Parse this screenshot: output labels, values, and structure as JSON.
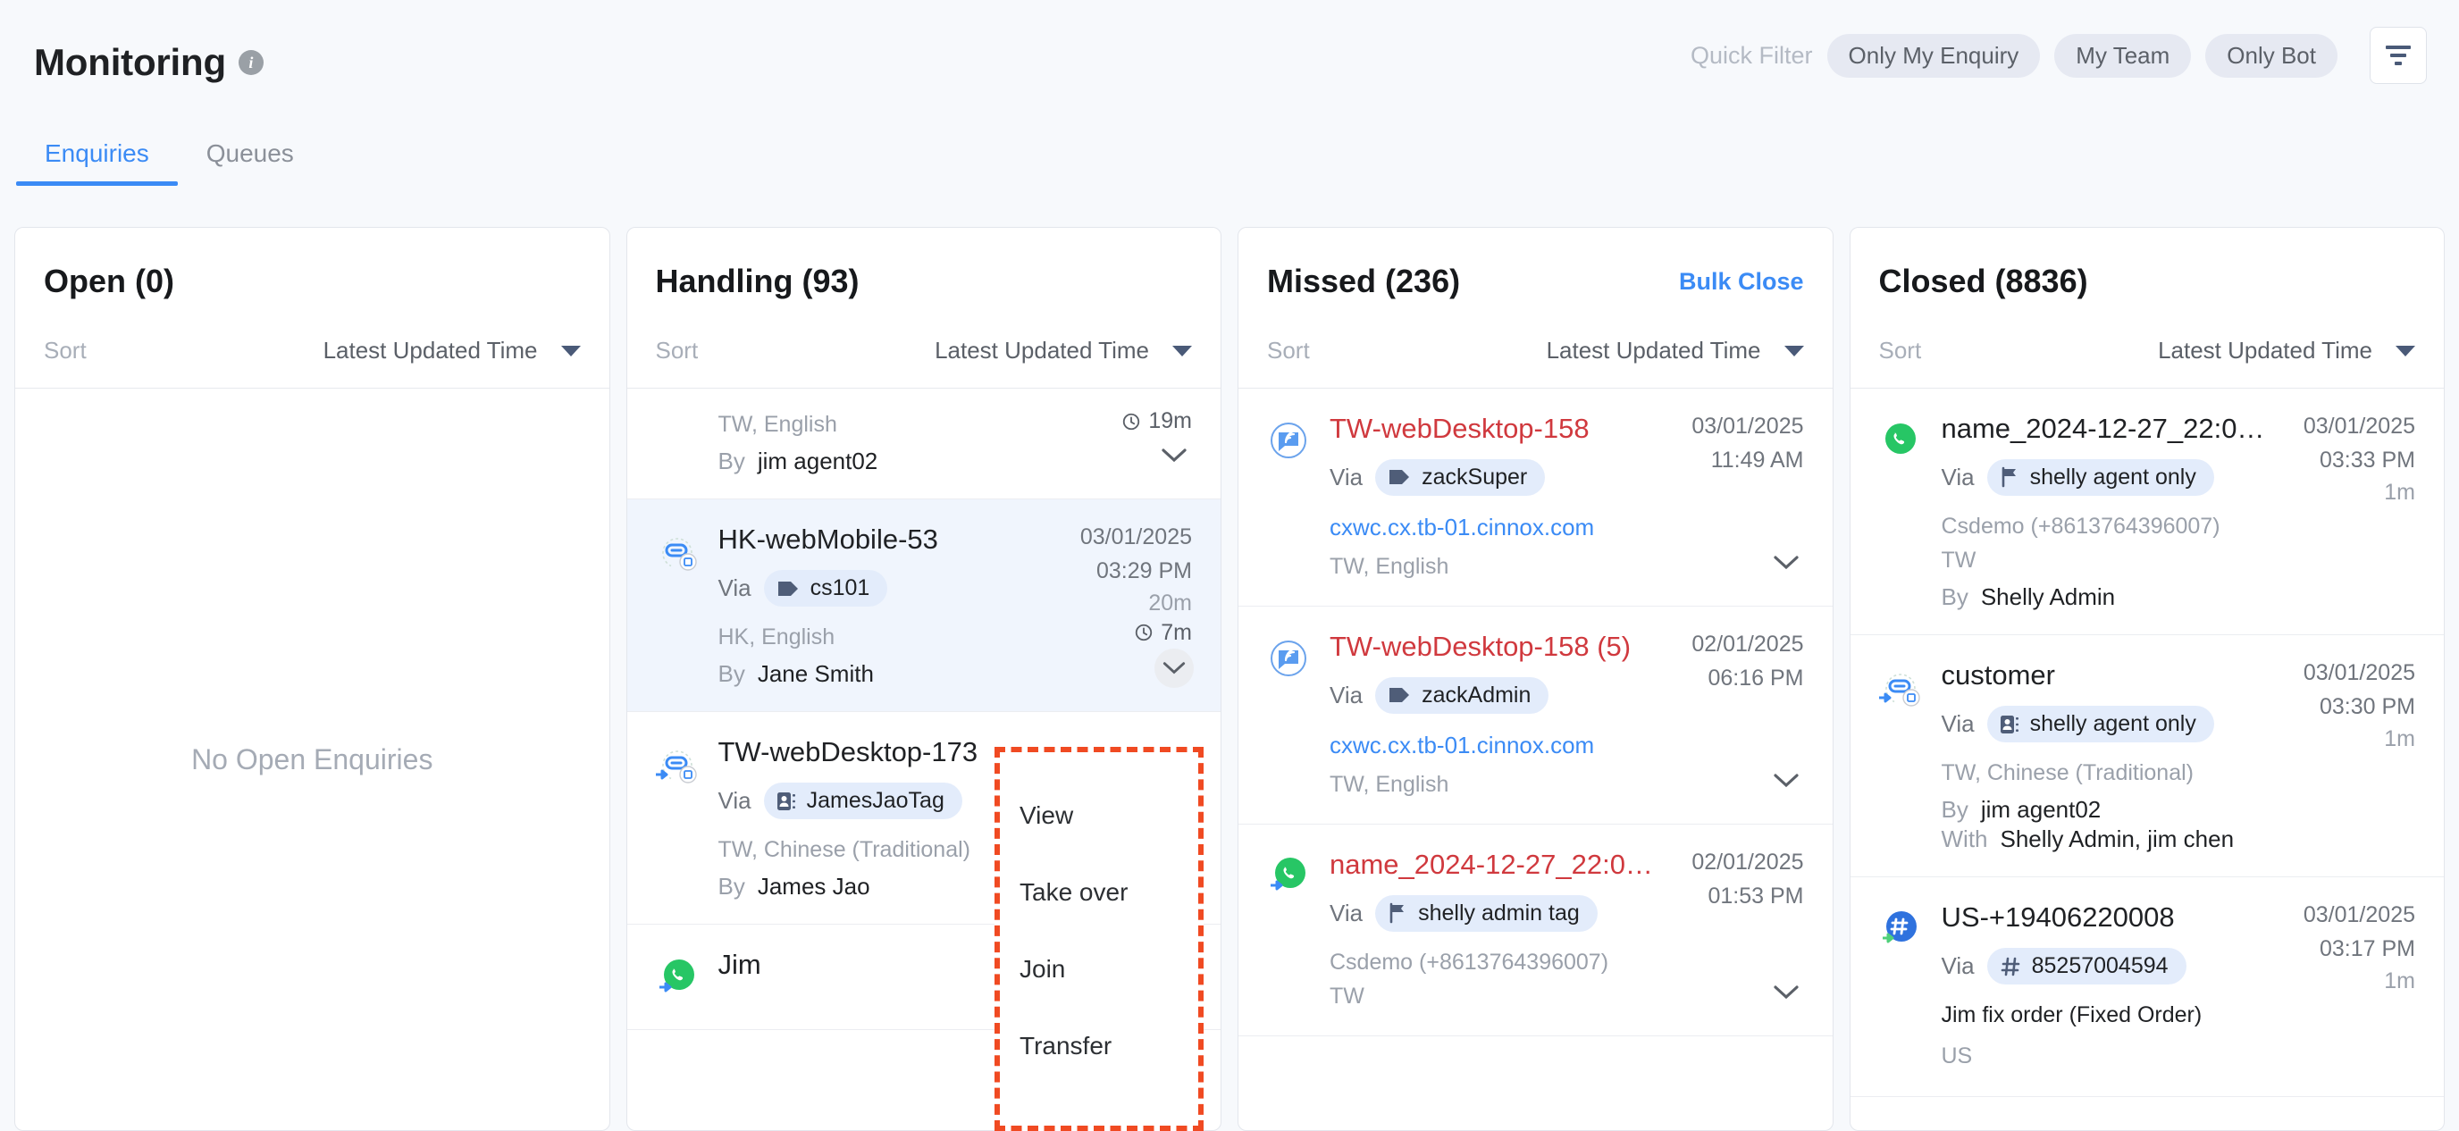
{
  "header": {
    "title": "Monitoring",
    "info_icon": "info-icon",
    "quick_filter_label": "Quick Filter",
    "chips": [
      {
        "label": "Only My Enquiry"
      },
      {
        "label": "My Team"
      },
      {
        "label": "Only Bot"
      }
    ],
    "filter_button_icon": "filter-icon"
  },
  "tabs": [
    {
      "label": "Enquiries",
      "active": true
    },
    {
      "label": "Queues",
      "active": false
    }
  ],
  "columns": [
    {
      "id": "open",
      "title": "Open (0)",
      "sort_label": "Sort",
      "sort_value": "Latest Updated Time",
      "empty_message": "No Open Enquiries",
      "cards": []
    },
    {
      "id": "handling",
      "title": "Handling (93)",
      "sort_label": "Sort",
      "sort_value": "Latest Updated Time",
      "cards": [
        {
          "partial": true,
          "timer": "19m",
          "locale": "TW, English",
          "by_label": "By",
          "by_value": "jim agent02"
        },
        {
          "selected": true,
          "icon": "link-mobile-icon",
          "name": "HK-webMobile-53",
          "via_label": "Via",
          "tag_label": "cs101",
          "tag_icon": "tag-icon",
          "locale": "HK, English",
          "by_label": "By",
          "by_value": "Jane Smith",
          "date": "03/01/2025",
          "time": "03:29 PM",
          "duration": "20m",
          "timer": "7m"
        },
        {
          "icon": "link-desktop-transfer-icon",
          "name": "TW-webDesktop-173",
          "via_label": "Via",
          "tag_label": "JamesJaoTag",
          "tag_icon": "contact-icon",
          "locale": "TW, Chinese (Traditional)",
          "by_label": "By",
          "by_value": "James Jao"
        },
        {
          "icon": "whatsapp-transfer-icon",
          "name": "Jim"
        }
      ]
    },
    {
      "id": "missed",
      "title": "Missed (236)",
      "action_label": "Bulk Close",
      "sort_label": "Sort",
      "sort_value": "Latest Updated Time",
      "cards": [
        {
          "icon": "webchat-icon",
          "name": "TW-webDesktop-158",
          "missed": true,
          "via_label": "Via",
          "tag_label": "zackSuper",
          "tag_icon": "tag-icon",
          "link": "cxwc.cx.tb-01.cinnox.com",
          "locale": "TW, English",
          "date": "03/01/2025",
          "time": "11:49 AM"
        },
        {
          "icon": "webchat-icon",
          "name": "TW-webDesktop-158 (5)",
          "missed": true,
          "via_label": "Via",
          "tag_label": "zackAdmin",
          "tag_icon": "tag-icon",
          "link": "cxwc.cx.tb-01.cinnox.com",
          "locale": "TW, English",
          "date": "02/01/2025",
          "time": "06:16 PM"
        },
        {
          "icon": "whatsapp-transfer-icon",
          "name": "name_2024-12-27_22:0…",
          "missed": true,
          "via_label": "Via",
          "tag_label": "shelly admin tag",
          "tag_icon": "flag-icon",
          "locale": "Csdemo (+8613764396007)",
          "locale2": "TW",
          "date": "02/01/2025",
          "time": "01:53 PM"
        }
      ]
    },
    {
      "id": "closed",
      "title": "Closed (8836)",
      "sort_label": "Sort",
      "sort_value": "Latest Updated Time",
      "cards": [
        {
          "icon": "whatsapp-icon",
          "name": "name_2024-12-27_22:0…",
          "via_label": "Via",
          "tag_label": "shelly agent only",
          "tag_icon": "flag-icon",
          "locale": "Csdemo (+8613764396007)",
          "locale2": "TW",
          "by_label": "By",
          "by_value": "Shelly Admin",
          "date": "03/01/2025",
          "time": "03:33 PM",
          "duration": "1m"
        },
        {
          "icon": "link-desktop-transfer-icon",
          "name": "customer",
          "via_label": "Via",
          "tag_label": "shelly agent only",
          "tag_icon": "contact-icon",
          "locale": "TW, Chinese (Traditional)",
          "by_label": "By",
          "by_value": "jim agent02",
          "with_label": "With",
          "with_value": "Shelly Admin, jim chen",
          "date": "03/01/2025",
          "time": "03:30 PM",
          "duration": "1m"
        },
        {
          "icon": "sms-transfer-icon",
          "name": "US-+19406220008",
          "via_label": "Via",
          "tag_label": "85257004594",
          "tag_icon": "hash-icon",
          "subtitle": "Jim fix order (Fixed Order)",
          "locale2": "US",
          "date": "03/01/2025",
          "time": "03:17 PM",
          "duration": "1m"
        }
      ]
    }
  ],
  "context_menu": {
    "items": [
      {
        "label": "View"
      },
      {
        "label": "Take over"
      },
      {
        "label": "Join"
      },
      {
        "label": "Transfer"
      }
    ]
  },
  "colors": {
    "accent": "#3b8bf5",
    "missed": "#d0393e",
    "highlight_border": "#f04a22",
    "whatsapp": "#27c665"
  }
}
